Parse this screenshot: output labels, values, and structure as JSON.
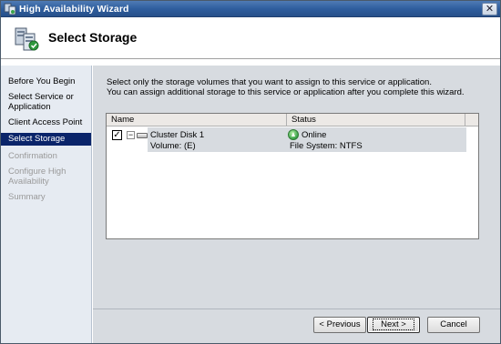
{
  "window": {
    "title": "High Availability Wizard"
  },
  "header": {
    "title": "Select Storage"
  },
  "nav": {
    "items": [
      {
        "label": "Before You Begin",
        "state": "normal"
      },
      {
        "label": "Select Service or Application",
        "state": "normal"
      },
      {
        "label": "Client Access Point",
        "state": "normal"
      },
      {
        "label": "Select Storage",
        "state": "selected"
      },
      {
        "label": "Confirmation",
        "state": "disabled"
      },
      {
        "label": "Configure High Availability",
        "state": "disabled"
      },
      {
        "label": "Summary",
        "state": "disabled"
      }
    ]
  },
  "main": {
    "description_line1": "Select only the storage volumes that you want to assign to this service or application.",
    "description_line2": "You can assign additional storage to this service or application after you complete this wizard.",
    "table": {
      "columns": [
        "Name",
        "Status"
      ],
      "rows": [
        {
          "checked": true,
          "name": "Cluster Disk 1",
          "status": "Online",
          "volume": "Volume: (E)",
          "filesystem": "File System: NTFS"
        }
      ]
    }
  },
  "footer": {
    "previous_label": "< Previous",
    "next_label": "Next >",
    "cancel_label": "Cancel"
  },
  "colors": {
    "titlebar": "#2f5e9e",
    "nav_background": "#e6ebf2",
    "nav_selected": "#0a246a",
    "content_background": "#d7dbe0"
  }
}
